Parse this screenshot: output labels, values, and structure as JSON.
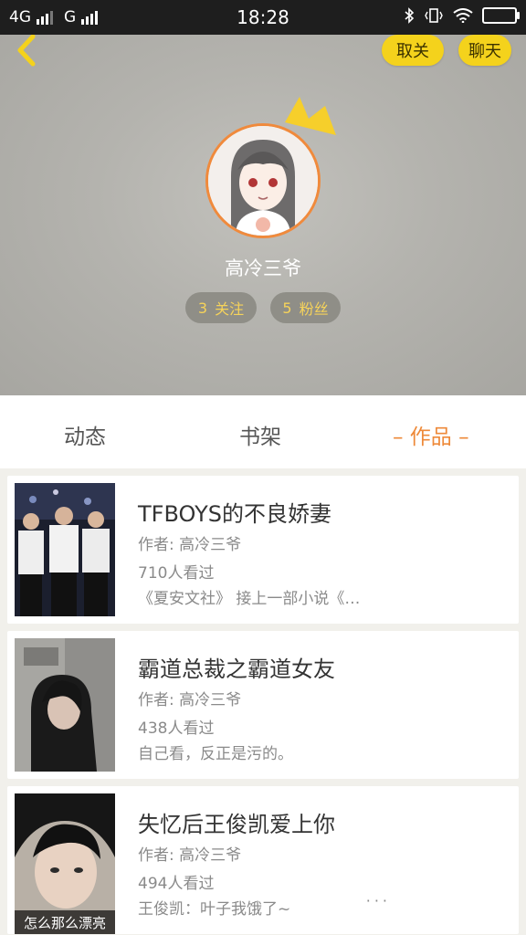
{
  "status_bar": {
    "network1": "4G",
    "network2": "G",
    "time": "18:28"
  },
  "header": {
    "unfollow_label": "取关",
    "chat_label": "聊天",
    "username": "高冷三爷",
    "following_count": "3",
    "following_label": "关注",
    "fans_count": "5",
    "fans_label": "粉丝"
  },
  "tabs": [
    {
      "label": "动态"
    },
    {
      "label": "书架"
    },
    {
      "label": "– 作品 –"
    }
  ],
  "works": [
    {
      "title": "TFBOYS的不良娇妻",
      "author": "作者: 高冷三爷",
      "views": "710人看过",
      "desc": "《夏安文社》 接上一部小说《…"
    },
    {
      "title": "霸道总裁之霸道女友",
      "author": "作者: 高冷三爷",
      "views": "438人看过",
      "desc": "自己看，反正是污的。"
    },
    {
      "title": "失忆后王俊凯爱上你",
      "author": "作者: 高冷三爷",
      "views": "494人看过",
      "desc": "王俊凯：叶子我饿了~",
      "more": "···",
      "cover_caption": "怎么那么漂亮"
    }
  ],
  "colors": {
    "accent_orange": "#ee8a3a",
    "pill_yellow": "#f4d21c",
    "stat_text": "#f6d35a"
  },
  "icons": [
    "back-arrow-icon",
    "crown-icon",
    "bluetooth-icon",
    "vibrate-icon",
    "wifi-icon",
    "battery-icon",
    "signal-icon"
  ]
}
